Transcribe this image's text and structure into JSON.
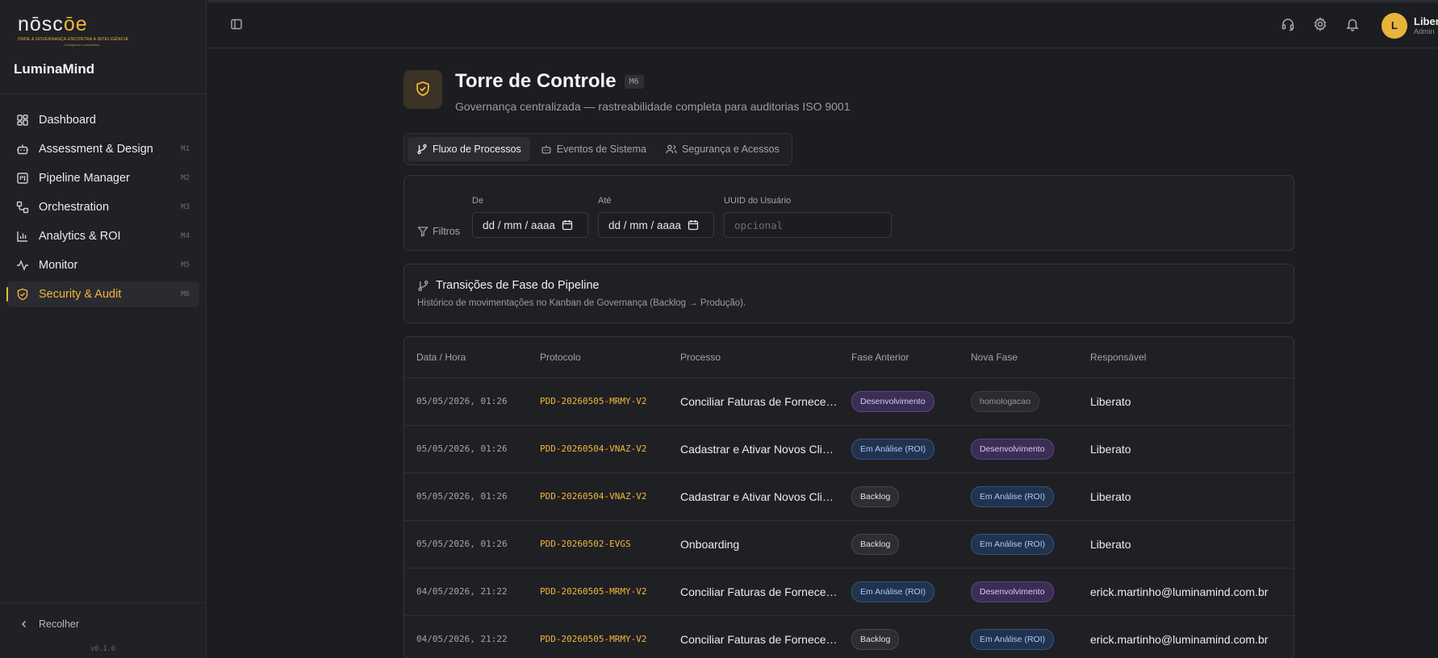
{
  "brand": {
    "logo_word_a": "nōsc",
    "logo_word_b": "ōe",
    "logo_tagline": "ONDE A GOVERNANÇA ENCONTRA A INTELIGÊNCIA",
    "logo_sub": "Inteligência LuminaMind",
    "app_name": "LuminaMind"
  },
  "sidebar": {
    "items": [
      {
        "label": "Dashboard",
        "badge": "",
        "icon": "dashboard-icon",
        "active": false
      },
      {
        "label": "Assessment & Design",
        "badge": "M1",
        "icon": "bot-icon",
        "active": false
      },
      {
        "label": "Pipeline Manager",
        "badge": "M2",
        "icon": "kanban-icon",
        "active": false
      },
      {
        "label": "Orchestration",
        "badge": "M3",
        "icon": "workflow-icon",
        "active": false
      },
      {
        "label": "Analytics & ROI",
        "badge": "M4",
        "icon": "bar-chart-icon",
        "active": false
      },
      {
        "label": "Monitor",
        "badge": "M5",
        "icon": "activity-icon",
        "active": false
      },
      {
        "label": "Security & Audit",
        "badge": "M6",
        "icon": "shield-check-icon",
        "active": true
      }
    ],
    "collapse_label": "Recolher",
    "version": "v0.1.0"
  },
  "topbar": {
    "user_name": "Liberato",
    "user_role": "Admin",
    "avatar_initial": "L"
  },
  "header": {
    "title": "Torre de Controle",
    "badge": "M6",
    "subtitle": "Governança centralizada — rastreabilidade completa para auditorias ISO 9001"
  },
  "tabs": [
    {
      "label": "Fluxo de Processos",
      "active": true
    },
    {
      "label": "Eventos de Sistema",
      "active": false
    },
    {
      "label": "Segurança e Acessos",
      "active": false
    }
  ],
  "filters": {
    "label": "Filtros",
    "from_label": "De",
    "from_value": "dd / mm / aaaa",
    "to_label": "Até",
    "to_value": "dd / mm / aaaa",
    "uuid_label": "UUID do Usuário",
    "uuid_placeholder": "opcional"
  },
  "section": {
    "title": "Transições de Fase do Pipeline",
    "description": "Histórico de movimentações no Kanban de Governança (Backlog → Produção)."
  },
  "table": {
    "columns": [
      "Data / Hora",
      "Protocolo",
      "Processo",
      "Fase Anterior",
      "Nova Fase",
      "Responsável"
    ],
    "rows": [
      {
        "date": "05/05/2026, 01:26",
        "protocol": "PDD-20260505-MRMY-V2",
        "process": "Conciliar Faturas de Fornecedores",
        "from": "Desenvolvimento",
        "from_kind": "dev",
        "to": "homologacao",
        "to_kind": "homolog",
        "owner": "Liberato"
      },
      {
        "date": "05/05/2026, 01:26",
        "protocol": "PDD-20260504-VNAZ-V2",
        "process": "Cadastrar e Ativar Novos Clientes",
        "from": "Em Análise (ROI)",
        "from_kind": "roi",
        "to": "Desenvolvimento",
        "to_kind": "dev",
        "owner": "Liberato"
      },
      {
        "date": "05/05/2026, 01:26",
        "protocol": "PDD-20260504-VNAZ-V2",
        "process": "Cadastrar e Ativar Novos Clientes",
        "from": "Backlog",
        "from_kind": "backlog",
        "to": "Em Análise (ROI)",
        "to_kind": "roi",
        "owner": "Liberato"
      },
      {
        "date": "05/05/2026, 01:26",
        "protocol": "PDD-20260502-EVGS",
        "process": "Onboarding",
        "from": "Backlog",
        "from_kind": "backlog",
        "to": "Em Análise (ROI)",
        "to_kind": "roi",
        "owner": "Liberato"
      },
      {
        "date": "04/05/2026, 21:22",
        "protocol": "PDD-20260505-MRMY-V2",
        "process": "Conciliar Faturas de Fornecedores",
        "from": "Em Análise (ROI)",
        "from_kind": "roi",
        "to": "Desenvolvimento",
        "to_kind": "dev",
        "owner": "erick.martinho@luminamind.com.br"
      },
      {
        "date": "04/05/2026, 21:22",
        "protocol": "PDD-20260505-MRMY-V2",
        "process": "Conciliar Faturas de Fornecedores",
        "from": "Backlog",
        "from_kind": "backlog",
        "to": "Em Análise (ROI)",
        "to_kind": "roi",
        "owner": "erick.martinho@luminamind.com.br"
      }
    ]
  },
  "colors": {
    "accent": "#f4b63a",
    "background": "#1c1d21",
    "sidebar": "#202125"
  }
}
